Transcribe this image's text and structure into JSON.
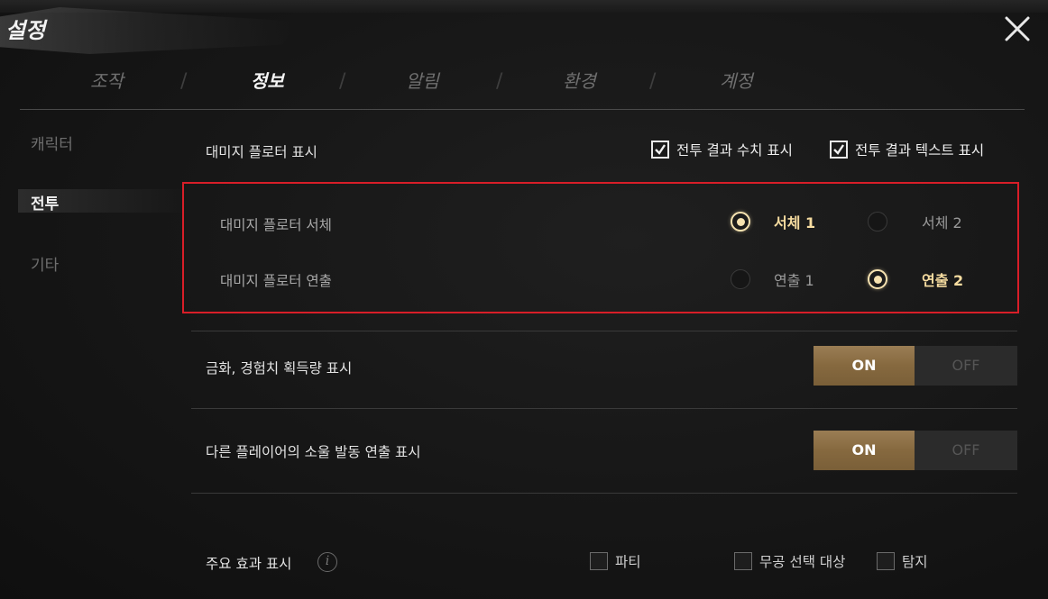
{
  "window": {
    "title": "설정",
    "close_icon": "close-icon"
  },
  "tabs": [
    {
      "label": "조작",
      "active": false
    },
    {
      "label": "정보",
      "active": true
    },
    {
      "label": "알림",
      "active": false
    },
    {
      "label": "환경",
      "active": false
    },
    {
      "label": "계정",
      "active": false
    }
  ],
  "sidebar": {
    "items": [
      {
        "label": "캐릭터",
        "active": false
      },
      {
        "label": "전투",
        "active": true
      },
      {
        "label": "기타",
        "active": false
      }
    ]
  },
  "damage_floater": {
    "label": "대미지 플로터 표시",
    "options": [
      {
        "label": "전투 결과 수치 표시",
        "checked": true
      },
      {
        "label": "전투 결과 텍스트 표시",
        "checked": true
      }
    ]
  },
  "font_setting": {
    "label": "대미지 플로터 서체",
    "options": [
      {
        "label": "서체 1",
        "selected": true
      },
      {
        "label": "서체 2",
        "selected": false
      }
    ]
  },
  "effect_setting": {
    "label": "대미지 플로터 연출",
    "options": [
      {
        "label": "연출 1",
        "selected": false
      },
      {
        "label": "연출 2",
        "selected": true
      }
    ]
  },
  "gold_exp": {
    "label": "금화, 경험치 획득량 표시",
    "on_label": "ON",
    "off_label": "OFF",
    "value": "ON"
  },
  "other_soul": {
    "label": "다른 플레이어의 소울 발동 연출 표시",
    "on_label": "ON",
    "off_label": "OFF",
    "value": "ON"
  },
  "main_effect": {
    "label": "주요 효과 표시",
    "info_icon": "i",
    "options": [
      {
        "label": "파티",
        "checked": false
      },
      {
        "label": "무공 선택 대상",
        "checked": false
      },
      {
        "label": "탐지",
        "checked": false
      }
    ]
  },
  "colors": {
    "accent_gold": "#f6dca0",
    "toggle_on": "#8a6d45",
    "highlight_border": "#d81e28"
  }
}
